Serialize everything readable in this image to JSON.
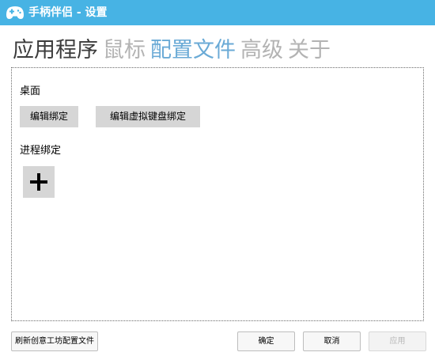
{
  "window": {
    "title": "手柄伴侣 - 设置",
    "icon": "gamepad-icon",
    "titlebar_color": "#47b3e4"
  },
  "tabs": [
    {
      "label": "应用程序",
      "active": true,
      "color": "#3c3c3c"
    },
    {
      "label": "鼠标",
      "active": false,
      "color": "#b3b3b3"
    },
    {
      "label": "配置文件",
      "active": false,
      "color": "#6aaad6"
    },
    {
      "label": "高级",
      "active": false,
      "color": "#b3b3b3"
    },
    {
      "label": "关于",
      "active": false,
      "color": "#b3b3b3"
    }
  ],
  "desktop": {
    "label": "桌面",
    "edit_bindings_label": "编辑绑定",
    "edit_virtual_keyboard_label": "编辑虚拟键盘绑定"
  },
  "process": {
    "label": "进程绑定",
    "add_icon": "plus-icon"
  },
  "footer": {
    "refresh_label": "刷新创意工坊配置文件",
    "ok_label": "确定",
    "cancel_label": "取消",
    "apply_label": "应用"
  }
}
